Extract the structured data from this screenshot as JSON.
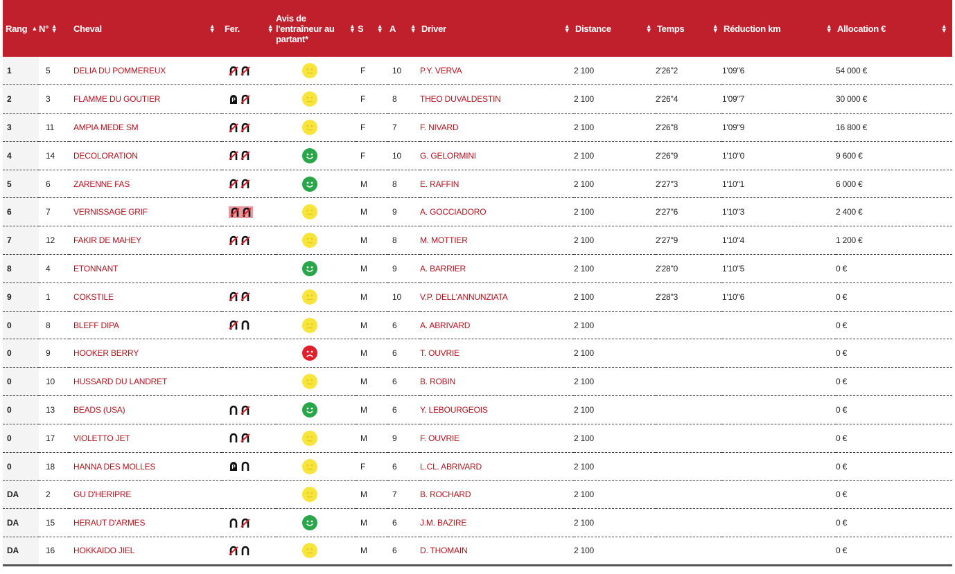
{
  "colors": {
    "header_bg": "#c0202c",
    "link": "#b3121e",
    "neutral": "#f7e53b",
    "happy": "#2aa64a",
    "sad": "#e01f2a"
  },
  "headers": {
    "rang": "Rang",
    "num": "N°",
    "cheval": "Cheval",
    "fer": "Fer.",
    "avis": "Avis de l'entraîneur au partant*",
    "s": "S",
    "a": "A",
    "driver": "Driver",
    "distance": "Distance",
    "temps": "Temps",
    "reduction": "Réduction km",
    "allocation": "Allocation €"
  },
  "rows": [
    {
      "rang": "1",
      "num": "5",
      "cheval": "DELIA DU POMMEREUX",
      "fer": [
        "barred",
        "barred"
      ],
      "fer_hl": false,
      "avis": "neutral",
      "s": "F",
      "a": "10",
      "driver": "P.Y. VERVA",
      "distance": "2 100",
      "temps": "2'26\"2",
      "reduction": "1'09\"6",
      "allocation": "54 000 €"
    },
    {
      "rang": "2",
      "num": "3",
      "cheval": "FLAMME DU GOUTIER",
      "fer": [
        "p",
        "barred"
      ],
      "fer_hl": false,
      "avis": "neutral",
      "s": "F",
      "a": "8",
      "driver": "THEO DUVALDESTIN",
      "distance": "2 100",
      "temps": "2'26\"4",
      "reduction": "1'09\"7",
      "allocation": "30 000 €"
    },
    {
      "rang": "3",
      "num": "11",
      "cheval": "AMPIA MEDE SM",
      "fer": [
        "barred",
        "barred"
      ],
      "fer_hl": false,
      "avis": "neutral",
      "s": "F",
      "a": "7",
      "driver": "F. NIVARD",
      "distance": "2 100",
      "temps": "2'26\"8",
      "reduction": "1'09\"9",
      "allocation": "16 800 €"
    },
    {
      "rang": "4",
      "num": "14",
      "cheval": "DECOLORATION",
      "fer": [
        "barred",
        "barred"
      ],
      "fer_hl": false,
      "avis": "happy",
      "s": "F",
      "a": "10",
      "driver": "G. GELORMINI",
      "distance": "2 100",
      "temps": "2'26\"9",
      "reduction": "1'10\"0",
      "allocation": "9 600 €"
    },
    {
      "rang": "5",
      "num": "6",
      "cheval": "ZARENNE FAS",
      "fer": [
        "barred",
        "barred"
      ],
      "fer_hl": false,
      "avis": "happy",
      "s": "M",
      "a": "8",
      "driver": "E. RAFFIN",
      "distance": "2 100",
      "temps": "2'27\"3",
      "reduction": "1'10\"1",
      "allocation": "6 000 €"
    },
    {
      "rang": "6",
      "num": "7",
      "cheval": "VERNISSAGE GRIF",
      "fer": [
        "barred",
        "barred"
      ],
      "fer_hl": true,
      "avis": "neutral",
      "s": "M",
      "a": "9",
      "driver": "A. GOCCIADORO",
      "distance": "2 100",
      "temps": "2'27\"6",
      "reduction": "1'10\"3",
      "allocation": "2 400 €"
    },
    {
      "rang": "7",
      "num": "12",
      "cheval": "FAKIR DE MAHEY",
      "fer": [
        "barred",
        "barred"
      ],
      "fer_hl": false,
      "avis": "neutral",
      "s": "M",
      "a": "8",
      "driver": "M. MOTTIER",
      "distance": "2 100",
      "temps": "2'27\"9",
      "reduction": "1'10\"4",
      "allocation": "1 200 €"
    },
    {
      "rang": "8",
      "num": "4",
      "cheval": "ETONNANT",
      "fer": [],
      "fer_hl": false,
      "avis": "happy",
      "s": "M",
      "a": "9",
      "driver": "A. BARRIER",
      "distance": "2 100",
      "temps": "2'28\"0",
      "reduction": "1'10\"5",
      "allocation": "0 €"
    },
    {
      "rang": "9",
      "num": "1",
      "cheval": "COKSTILE",
      "fer": [
        "barred",
        "barred"
      ],
      "fer_hl": false,
      "avis": "neutral",
      "s": "M",
      "a": "10",
      "driver": "V.P. DELL'ANNUNZIATA",
      "distance": "2 100",
      "temps": "2'28\"3",
      "reduction": "1'10\"6",
      "allocation": "0 €"
    },
    {
      "rang": "0",
      "num": "8",
      "cheval": "BLEFF DIPA",
      "fer": [
        "barred",
        "open"
      ],
      "fer_hl": false,
      "avis": "neutral",
      "s": "M",
      "a": "6",
      "driver": "A. ABRIVARD",
      "distance": "2 100",
      "temps": "",
      "reduction": "",
      "allocation": "0 €"
    },
    {
      "rang": "0",
      "num": "9",
      "cheval": "HOOKER BERRY",
      "fer": [],
      "fer_hl": false,
      "avis": "sad",
      "s": "M",
      "a": "6",
      "driver": "T. OUVRIE",
      "distance": "2 100",
      "temps": "",
      "reduction": "",
      "allocation": "0 €"
    },
    {
      "rang": "0",
      "num": "10",
      "cheval": "HUSSARD DU LANDRET",
      "fer": [],
      "fer_hl": false,
      "avis": "neutral",
      "s": "M",
      "a": "6",
      "driver": "B. ROBIN",
      "distance": "2 100",
      "temps": "",
      "reduction": "",
      "allocation": "0 €"
    },
    {
      "rang": "0",
      "num": "13",
      "cheval": "BEADS (USA)",
      "fer": [
        "open",
        "barred"
      ],
      "fer_hl": false,
      "avis": "happy",
      "s": "M",
      "a": "6",
      "driver": "Y. LEBOURGEOIS",
      "distance": "2 100",
      "temps": "",
      "reduction": "",
      "allocation": "0 €"
    },
    {
      "rang": "0",
      "num": "17",
      "cheval": "VIOLETTO JET",
      "fer": [
        "open",
        "barred"
      ],
      "fer_hl": false,
      "avis": "neutral",
      "s": "M",
      "a": "9",
      "driver": "F. OUVRIE",
      "distance": "2 100",
      "temps": "",
      "reduction": "",
      "allocation": "0 €"
    },
    {
      "rang": "0",
      "num": "18",
      "cheval": "HANNA DES MOLLES",
      "fer": [
        "p",
        "open"
      ],
      "fer_hl": false,
      "avis": "neutral",
      "s": "F",
      "a": "6",
      "driver": "L.CL. ABRIVARD",
      "distance": "2 100",
      "temps": "",
      "reduction": "",
      "allocation": "0 €"
    },
    {
      "rang": "DA",
      "num": "2",
      "cheval": "GU D'HERIPRE",
      "fer": [],
      "fer_hl": false,
      "avis": "neutral",
      "s": "M",
      "a": "7",
      "driver": "B. ROCHARD",
      "distance": "2 100",
      "temps": "",
      "reduction": "",
      "allocation": "0 €"
    },
    {
      "rang": "DA",
      "num": "15",
      "cheval": "HERAUT D'ARMES",
      "fer": [
        "open",
        "barred"
      ],
      "fer_hl": false,
      "avis": "happy",
      "s": "M",
      "a": "6",
      "driver": "J.M. BAZIRE",
      "distance": "2 100",
      "temps": "",
      "reduction": "",
      "allocation": "0 €"
    },
    {
      "rang": "DA",
      "num": "16",
      "cheval": "HOKKAIDO JIEL",
      "fer": [
        "barred",
        "open"
      ],
      "fer_hl": false,
      "avis": "neutral",
      "s": "M",
      "a": "6",
      "driver": "D. THOMAIN",
      "distance": "2 100",
      "temps": "",
      "reduction": "",
      "allocation": "0 €"
    }
  ]
}
